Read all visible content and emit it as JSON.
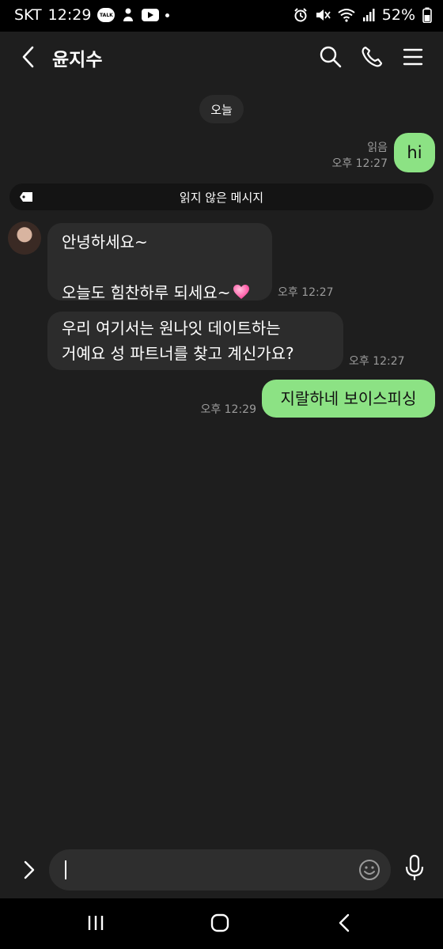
{
  "status_bar": {
    "carrier": "SKT",
    "time": "12:29",
    "talk_badge": "TALK",
    "battery": "52%"
  },
  "header": {
    "title": "윤지수"
  },
  "date_chip": "오늘",
  "messages": [
    {
      "direction": "out",
      "text": "hi",
      "read_label": "읽음",
      "time": "오후 12:27"
    },
    {
      "direction": "in",
      "text": "안녕하세요~\n\n오늘도 힘찬하루 되세요~",
      "emoji": "heart",
      "time": "오후 12:27"
    },
    {
      "direction": "in",
      "text": "우리 여기서는 원나잇 데이트하는\n거예요 성 파트너를 찾고 계신가요?",
      "time": "오후 12:27"
    },
    {
      "direction": "out",
      "text": "지랄하네 보이스피싱",
      "time": "오후 12:29"
    }
  ],
  "unread_divider": "읽지 않은 메시지",
  "input": {
    "value": ""
  },
  "colors": {
    "outgoing_bubble": "#8ce284",
    "incoming_bubble": "#2c2c2c",
    "background": "#1e1e1e"
  },
  "icons": [
    "back-icon",
    "search-icon",
    "phone-icon",
    "menu-icon",
    "tag-icon",
    "heart-emoji",
    "expand-icon",
    "emoji-icon",
    "mic-icon",
    "recents-icon",
    "home-icon",
    "nav-back-icon"
  ]
}
